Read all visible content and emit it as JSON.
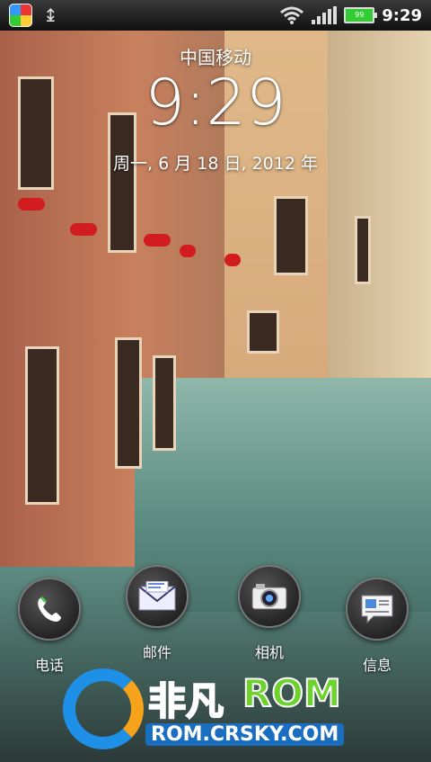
{
  "statusbar": {
    "app_icon": "colorful-square-icon",
    "usb_icon": "usb-icon",
    "wifi_icon": "wifi-icon",
    "signal_icon": "signal-bars-icon",
    "battery_level": "99",
    "time": "9:29"
  },
  "lockscreen": {
    "carrier": "中国移动",
    "clock": "9:29",
    "date": "周一, 6 月 18 日, 2012 年"
  },
  "dock": {
    "items": [
      {
        "label": "电话",
        "icon": "phone-icon"
      },
      {
        "label": "邮件",
        "icon": "mail-icon"
      },
      {
        "label": "相机",
        "icon": "camera-icon"
      },
      {
        "label": "信息",
        "icon": "message-icon"
      }
    ]
  },
  "watermark": {
    "brand": "非凡",
    "rom": "ROM",
    "url": "ROM.CRSKY.COM"
  }
}
